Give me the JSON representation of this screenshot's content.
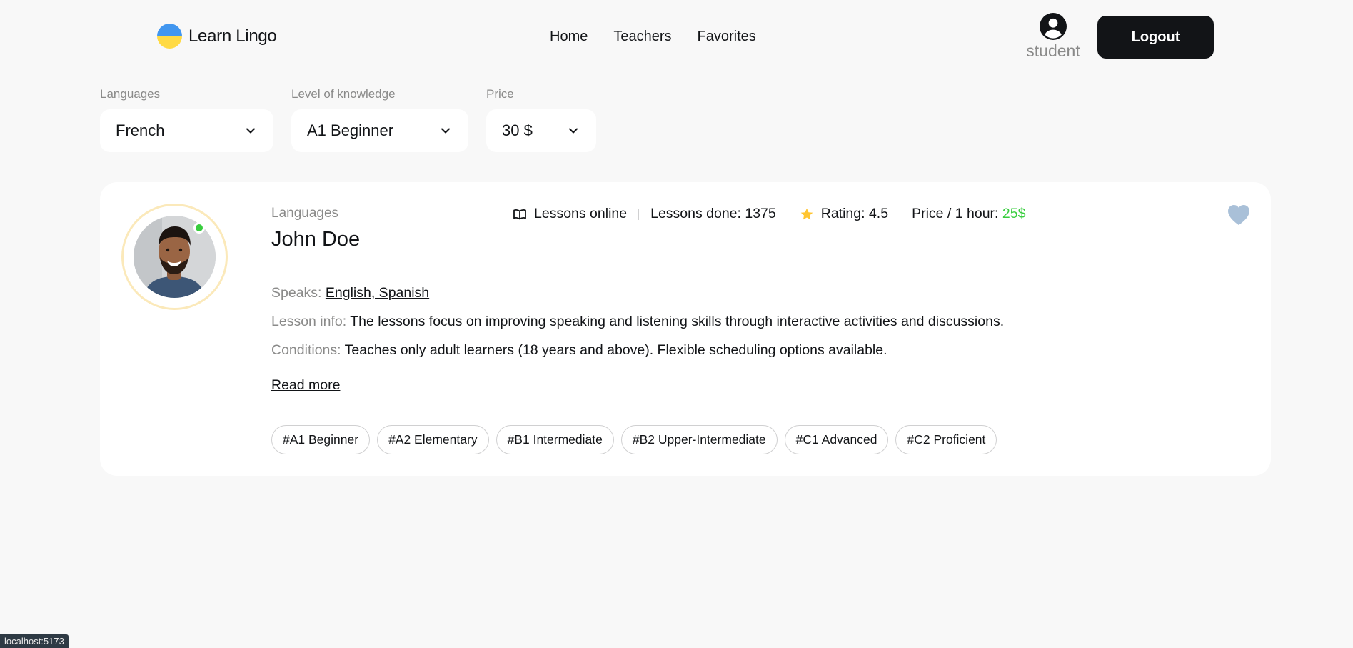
{
  "header": {
    "logo_text": "Learn Lingo",
    "nav": [
      "Home",
      "Teachers",
      "Favorites"
    ],
    "user_label": "student",
    "logout_label": "Logout"
  },
  "filters": {
    "languages": {
      "label": "Languages",
      "value": "French"
    },
    "level": {
      "label": "Level of knowledge",
      "value": "A1 Beginner"
    },
    "price": {
      "label": "Price",
      "value": "30 $"
    }
  },
  "teacher": {
    "category": "Languages",
    "name": "John Doe",
    "lessons_online": "Lessons online",
    "lessons_done": "Lessons done: 1375",
    "rating": "Rating: 4.5",
    "price_label": "Price / 1 hour:",
    "price_value": "25$",
    "speaks_label": "Speaks:",
    "speaks_value": "English, Spanish",
    "lesson_info_label": "Lesson info:",
    "lesson_info_value": "The lessons focus on improving speaking and listening skills through interactive activities and discussions.",
    "conditions_label": "Conditions:",
    "conditions_value": "Teaches only adult learners (18 years and above). Flexible scheduling options available.",
    "read_more": "Read more",
    "tags": [
      "#A1 Beginner",
      "#A2 Elementary",
      "#B1 Intermediate",
      "#B2 Upper-Intermediate",
      "#C1 Advanced",
      "#C2 Proficient"
    ],
    "online": true,
    "favorite": false
  },
  "statusbar": "localhost:5173",
  "colors": {
    "accent_dark": "#121417",
    "muted": "#8a8a89",
    "price_green": "#38cd3e",
    "heart": "#a9c0d8",
    "star": "#ffc531",
    "background": "#f8f8f8"
  },
  "icons": [
    "user-circle-icon",
    "chevron-down-icon",
    "book-open-icon",
    "star-icon",
    "heart-icon"
  ]
}
